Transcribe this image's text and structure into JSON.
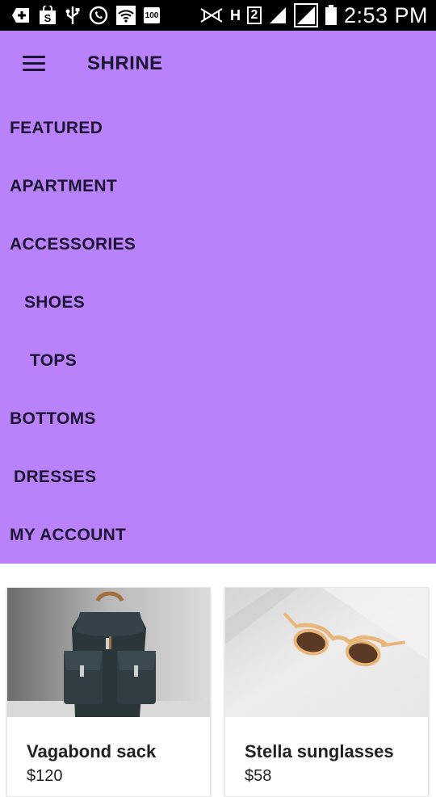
{
  "status_bar": {
    "time": "2:53 PM",
    "icons": [
      "add-box-icon",
      "shopping-bag-icon",
      "usb-icon",
      "whatsapp-icon",
      "wifi-icon",
      "battery-saver-icon",
      "vibrate-icon",
      "network-h-icon",
      "sim-2-icon",
      "signal-icon",
      "signal-icon",
      "battery-icon"
    ],
    "badge_100": "100",
    "network_h": "H",
    "sim_slot": "2"
  },
  "app_bar": {
    "title": "SHRINE",
    "menu_icon": "menu-icon"
  },
  "menu": {
    "items": [
      {
        "label": "FEATURED"
      },
      {
        "label": "APARTMENT"
      },
      {
        "label": "ACCESSORIES"
      },
      {
        "label": "SHOES"
      },
      {
        "label": "TOPS"
      },
      {
        "label": "BOTTOMS"
      },
      {
        "label": "DRESSES"
      },
      {
        "label": "MY ACCOUNT"
      }
    ]
  },
  "colors": {
    "backdrop": "#b982fb",
    "text_dark": "#1c1433"
  },
  "products": [
    {
      "name": "Vagabond sack",
      "price": "$120",
      "image": "backpack-image"
    },
    {
      "name": "Stella sunglasses",
      "price": "$58",
      "image": "sunglasses-image"
    }
  ]
}
